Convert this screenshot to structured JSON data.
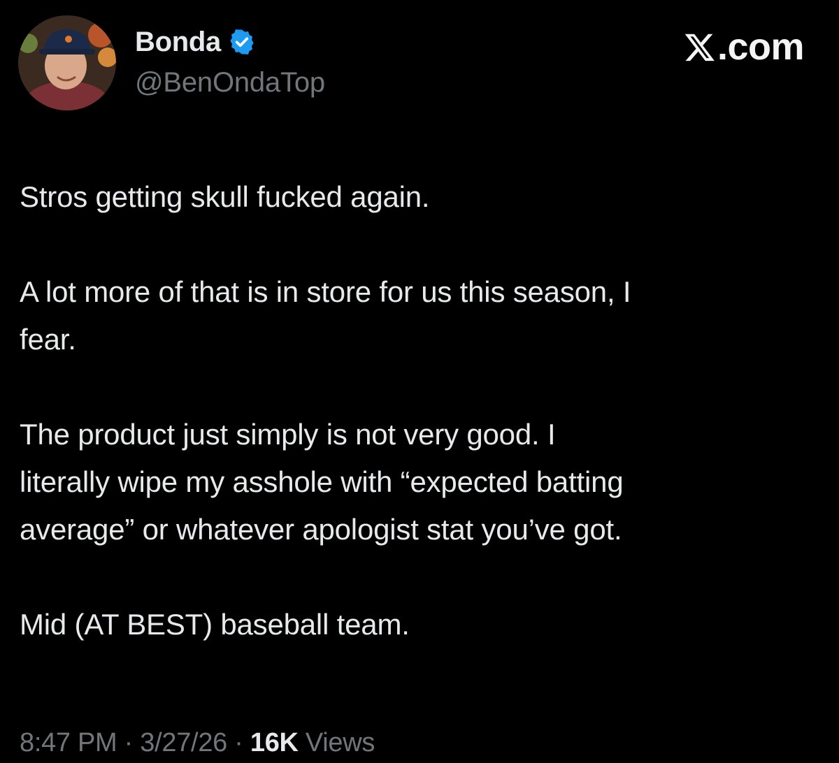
{
  "author": {
    "display_name": "Bonda",
    "handle": "@BenOndaTop",
    "verified": true,
    "verified_color": "#1d9bf0"
  },
  "brand": {
    "label": ".com",
    "icon": "x-logo-icon"
  },
  "tweet": {
    "paragraphs": [
      "Stros getting skull fucked again.",
      "A lot more of that is in store for us this season, I\nfear.",
      "The product just simply is not very good. I\nliterally wipe my asshole with “expected batting\naverage” or whatever apologist stat you’ve got.",
      "Mid (AT BEST) baseball team."
    ]
  },
  "meta": {
    "time": "8:47 PM",
    "separator": " · ",
    "date": "3/27/26",
    "views_count": "16K",
    "views_label": " Views"
  },
  "colors": {
    "background": "#000000",
    "text": "#e7e9ea",
    "secondary_text": "#71767b"
  }
}
